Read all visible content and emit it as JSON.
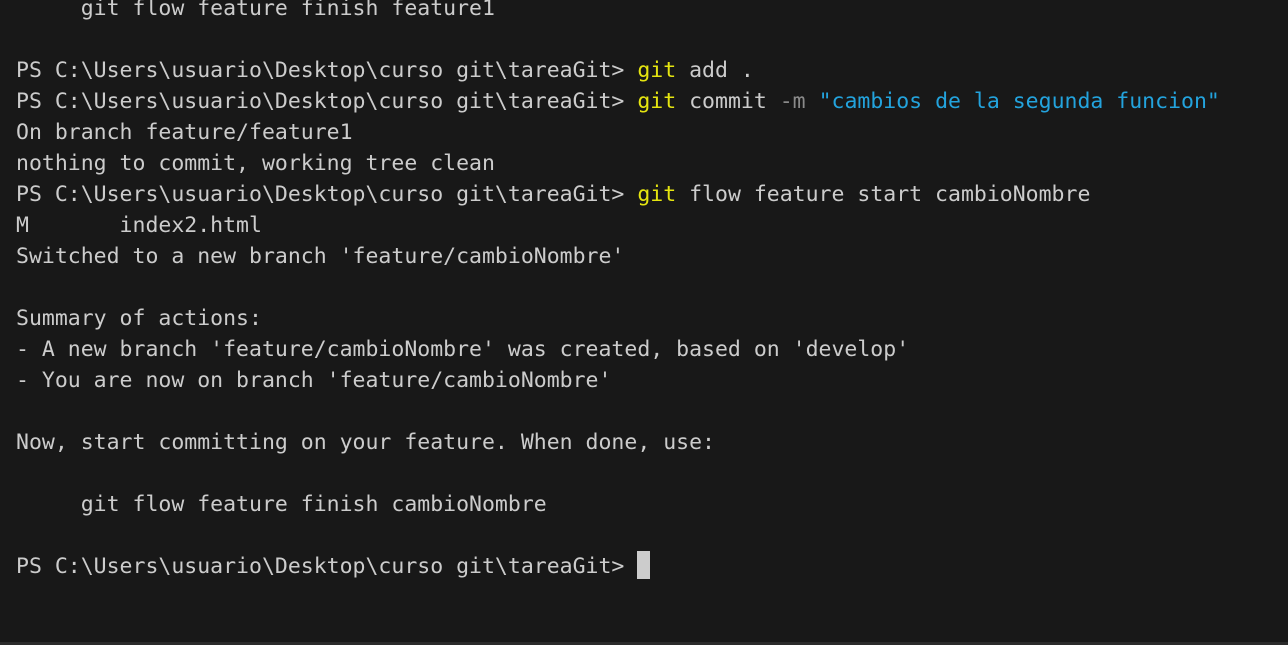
{
  "terminal": {
    "line_top": "     git flow feature finish feature1",
    "prompt": "PS C:\\Users\\usuario\\Desktop\\curso git\\tareaGit> ",
    "cmd1": {
      "git": "git",
      "rest": " add ."
    },
    "cmd2": {
      "git": "git",
      "rest": " commit ",
      "flag": "-m",
      "sp": " ",
      "str": "\"cambios de la segunda funcion\""
    },
    "out_branch": "On branch feature/feature1",
    "out_clean": "nothing to commit, working tree clean",
    "cmd3": {
      "git": "git",
      "rest": " flow feature start cambioNombre"
    },
    "out_modified": "M       index2.html",
    "out_switched": "Switched to a new branch 'feature/cambioNombre'",
    "summary_title": "Summary of actions:",
    "summary_item1": "- A new branch 'feature/cambioNombre' was created, based on 'develop'",
    "summary_item2": "- You are now on branch 'feature/cambioNombre'",
    "now_start": "Now, start committing on your feature. When done, use:",
    "finish_cmd": "     git flow feature finish cambioNombre"
  },
  "colors": {
    "background": "#181818",
    "text": "#cccccc",
    "command": "#e5e510",
    "flag": "#8a8a8a",
    "string": "#23a3dd"
  }
}
